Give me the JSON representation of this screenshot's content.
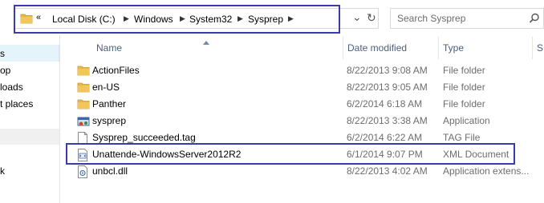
{
  "address_bar": {
    "overflow_label": "«",
    "crumbs": [
      "Local Disk (C:)",
      "Windows",
      "System32",
      "Sysprep"
    ],
    "separator": "▶",
    "dropdown_glyph": "⌄",
    "refresh_glyph": "↻"
  },
  "search": {
    "placeholder": "Search Sysprep",
    "icon": "search-icon"
  },
  "nav_pane": {
    "items": [
      "s",
      "op",
      "loads",
      "t places",
      "k"
    ]
  },
  "columns": {
    "name": "Name",
    "date": "Date modified",
    "type": "Type",
    "extra": "S"
  },
  "files": [
    {
      "name": "ActionFiles",
      "date": "8/22/2013 9:08 AM",
      "type": "File folder",
      "icon": "folder-icon"
    },
    {
      "name": "en-US",
      "date": "8/22/2013 9:05 AM",
      "type": "File folder",
      "icon": "folder-icon"
    },
    {
      "name": "Panther",
      "date": "6/2/2014 6:18 AM",
      "type": "File folder",
      "icon": "folder-icon"
    },
    {
      "name": "sysprep",
      "date": "8/22/2013 3:38 AM",
      "type": "Application",
      "icon": "application-icon"
    },
    {
      "name": "Sysprep_succeeded.tag",
      "date": "6/2/2014 6:22 AM",
      "type": "TAG File",
      "icon": "file-icon"
    },
    {
      "name": "Unattende-WindowsServer2012R2",
      "date": "6/1/2014 9:07 PM",
      "type": "XML Document",
      "icon": "xml-file-icon"
    },
    {
      "name": "unbcl.dll",
      "date": "8/22/2013 4:02 AM",
      "type": "Application extens...",
      "icon": "dll-file-icon"
    }
  ],
  "colors": {
    "highlight_border": "#3b3bb0",
    "folder": "#e8b64a",
    "header_text": "#4c607a"
  }
}
